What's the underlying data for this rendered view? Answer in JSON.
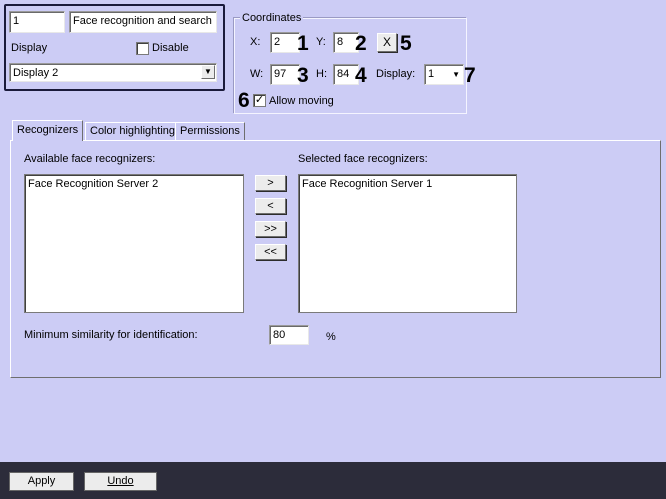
{
  "object": {
    "id": "1",
    "name": "Face recognition and search",
    "display_label": "Display",
    "disable_label": "Disable",
    "display_value": "Display 2"
  },
  "coordinates": {
    "title": "Coordinates",
    "x_label": "X:",
    "x_value": "2",
    "y_label": "Y:",
    "y_value": "8",
    "w_label": "W:",
    "w_value": "97",
    "h_label": "H:",
    "h_value": "84",
    "display_label": "Display:",
    "display_value": "1",
    "allow_moving_label": "Allow moving",
    "reset_button": "X"
  },
  "callouts": [
    "1",
    "2",
    "3",
    "4",
    "5",
    "6",
    "7"
  ],
  "tabs": [
    "Recognizers",
    "Color highlighting",
    "Permissions"
  ],
  "recognizers": {
    "available_label": "Available face recognizers:",
    "available_items": [
      "Face Recognition Server 2"
    ],
    "selected_label": "Selected face recognizers:",
    "selected_items": [
      "Face Recognition Server 1"
    ],
    "move_buttons": [
      ">",
      "<",
      ">>",
      "<<"
    ],
    "similarity_label": "Minimum similarity for identification:",
    "similarity_value": "80",
    "similarity_unit": "%"
  },
  "footer": {
    "apply": "Apply",
    "undo": "Undo"
  },
  "icons": {
    "checkbox_check": "check-icon",
    "dropdown": "chevron-down-icon"
  }
}
